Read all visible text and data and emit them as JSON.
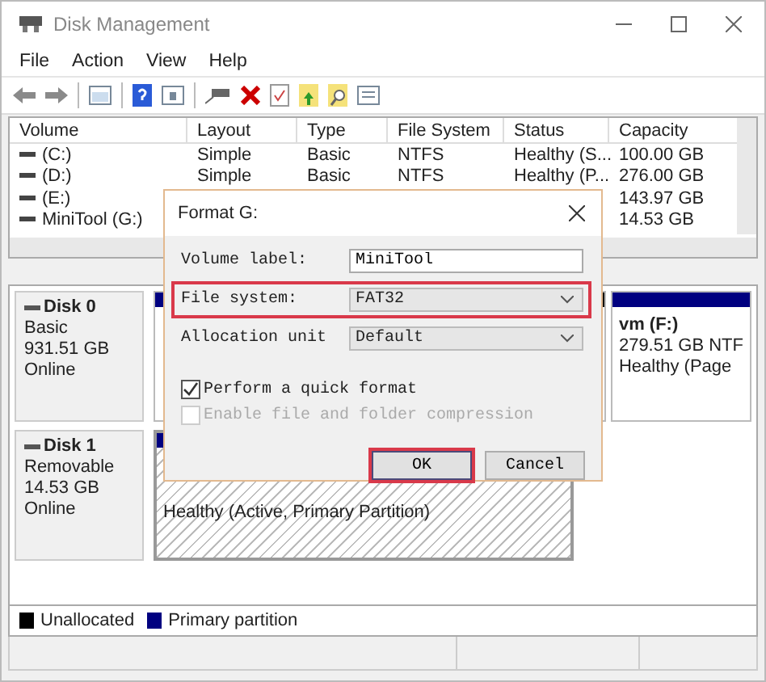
{
  "window": {
    "title": "Disk Management"
  },
  "menu": [
    "File",
    "Action",
    "View",
    "Help"
  ],
  "table": {
    "columns": [
      "Volume",
      "Layout",
      "Type",
      "File System",
      "Status",
      "Capacity"
    ],
    "rows": [
      {
        "cells": [
          "(C:)",
          "Simple",
          "Basic",
          "NTFS",
          "Healthy (S...",
          "100.00 GB"
        ]
      },
      {
        "cells": [
          "(D:)",
          "Simple",
          "Basic",
          "NTFS",
          "Healthy (P...",
          "276.00 GB"
        ]
      },
      {
        "cells": [
          "(E:)",
          "",
          "",
          "",
          "",
          "143.97 GB"
        ]
      },
      {
        "cells": [
          "MiniTool (G:)",
          "",
          "",
          "",
          "",
          "14.53 GB"
        ]
      }
    ]
  },
  "disks": [
    {
      "name": "Disk 0",
      "details": [
        "Basic",
        "931.51 GB",
        "Online"
      ],
      "partitions": [
        {
          "kind": "primary",
          "selected": false
        },
        {
          "kind": "unallocated",
          "selected": false
        },
        {
          "kind": "primary",
          "selected": false,
          "title": "vm  (F:)",
          "lines": [
            "279.51 GB NTF",
            "Healthy (Page"
          ]
        }
      ]
    },
    {
      "name": "Disk 1",
      "details": [
        "Removable",
        "14.53 GB",
        "Online"
      ],
      "partitions": [
        {
          "kind": "primary",
          "selected": true,
          "lines": [
            "Healthy (Active, Primary Partition)"
          ]
        }
      ]
    }
  ],
  "legend": [
    {
      "label": "Unallocated",
      "color": "#000000"
    },
    {
      "label": "Primary partition",
      "color": "#000080"
    }
  ],
  "dialog": {
    "title": "Format G:",
    "fields": [
      {
        "kind": "text",
        "label": "Volume label:",
        "value": "MiniTool",
        "highlighted": false
      },
      {
        "kind": "select",
        "label": "File system:",
        "value": "FAT32",
        "highlighted": true
      },
      {
        "kind": "select",
        "label": "Allocation unit",
        "value": "Default",
        "highlighted": false
      }
    ],
    "options": [
      {
        "label": "Perform a quick format",
        "checked": true,
        "disabled": false
      },
      {
        "label": "Enable file and folder compression",
        "checked": false,
        "disabled": true
      }
    ],
    "buttons": [
      {
        "label": "OK",
        "highlighted": true
      },
      {
        "label": "Cancel",
        "highlighted": false
      }
    ]
  }
}
